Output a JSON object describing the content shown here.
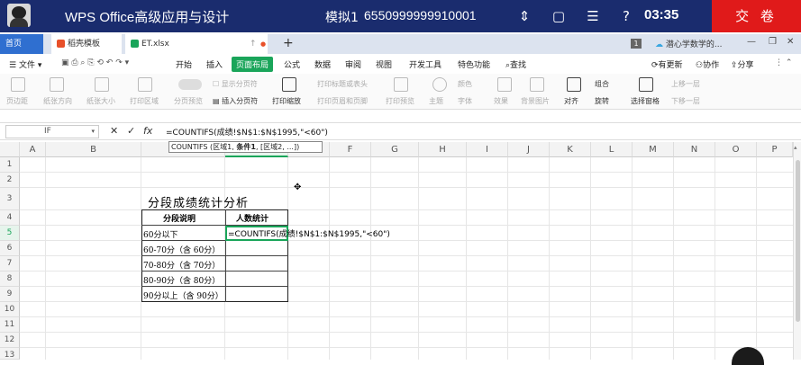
{
  "exam_bar": {
    "title": "WPS Office高级应用与设计",
    "mode": "模拟1",
    "exam_number": "6550999999910001",
    "time": "03:35",
    "submit_label": "交 卷"
  },
  "tabs": {
    "home": "首页",
    "templates": "稻壳模板",
    "file": "ET.xlsx",
    "badge": "1",
    "cloud": "潜心学数学的..."
  },
  "menu": {
    "file": "文件",
    "items": [
      "开始",
      "插入",
      "页面布局",
      "公式",
      "数据",
      "审阅",
      "视图",
      "开发工具",
      "特色功能",
      "查找"
    ],
    "active": "页面布局",
    "right": [
      "有更新",
      "协作",
      "分享"
    ]
  },
  "ribbon": {
    "items": [
      "页边距",
      "纸张方向",
      "纸张大小",
      "打印区域",
      "分页预览",
      "显示分页符",
      "插入分页符",
      "打印缩放",
      "打印标题或表头",
      "打印页眉和页脚",
      "打印预览",
      "主题",
      "颜色",
      "字体",
      "效果",
      "背景图片",
      "对齐",
      "组合",
      "旋转",
      "选择窗格",
      "上移一层",
      "下移一层"
    ]
  },
  "formula_bar": {
    "name_box": "IF",
    "fx": "fx",
    "formula": "=COUNTIFS(成绩!$N$1:$N$1995,\"<60\")",
    "tooltip_prefix": "COUNTIFS (区域1, ",
    "tooltip_bold": "条件1",
    "tooltip_suffix": ", [区域2, ...])"
  },
  "columns": [
    "A",
    "B",
    "C",
    "D",
    "E",
    "F",
    "G",
    "H",
    "I",
    "J",
    "K",
    "L",
    "M",
    "N",
    "O",
    "P"
  ],
  "rows": [
    "1",
    "2",
    "3",
    "4",
    "5",
    "6",
    "7",
    "8",
    "9",
    "10",
    "11",
    "12",
    "13"
  ],
  "sheet": {
    "title": "分段成绩统计分析",
    "header": [
      "分段说明",
      "人数统计"
    ],
    "rows": [
      "60分以下",
      "60-70分（含 60分）",
      "70-80分（含 70分）",
      "80-90分（含 80分）",
      "90分以上（含 90分）"
    ],
    "editing_text": "=COUNTIFS(成绩!$N$1:$N$1995,\"<60\")"
  },
  "colors": {
    "exam_bar": "#1a2c6e",
    "submit": "#e01a1a",
    "accent": "#1aa55a",
    "home_tab": "#2f6fd0"
  }
}
